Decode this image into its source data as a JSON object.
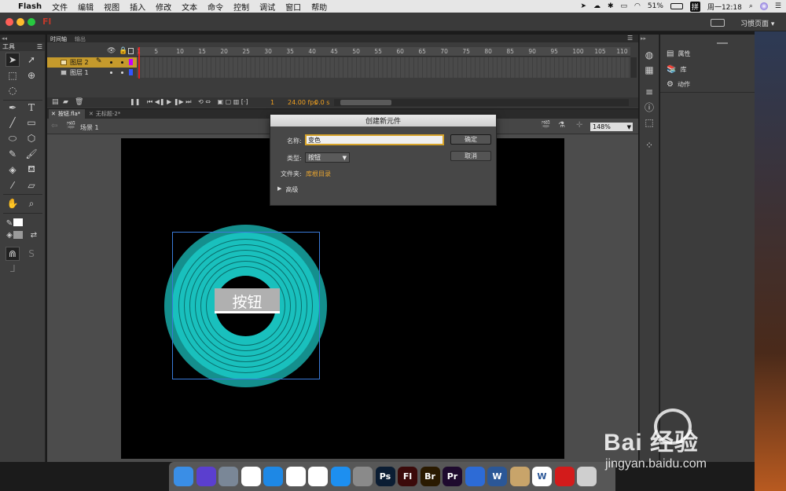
{
  "menubar": {
    "apple": "",
    "app": "Flash",
    "items": [
      "文件",
      "编辑",
      "视图",
      "插入",
      "修改",
      "文本",
      "命令",
      "控制",
      "调试",
      "窗口",
      "帮助"
    ],
    "battery": "51%",
    "input_method": "拼",
    "clock": "周一12:18"
  },
  "titlebar": {
    "app_icon": "Fl",
    "workspace": "习惯页面"
  },
  "tools": {
    "label": "工具",
    "icons": [
      "selection-tool",
      "subselection-tool",
      "free-transform-tool",
      "3d-rotation-tool",
      "lasso-tool",
      "pen-tool",
      "text-tool",
      "line-tool",
      "rectangle-tool",
      "oval-tool",
      "polystar-tool",
      "pencil-tool",
      "brush-tool",
      "paint-bucket-tool",
      "ink-bottle-tool",
      "eyedropper-tool",
      "eraser-tool",
      "hand-tool",
      "zoom-tool"
    ]
  },
  "timeline": {
    "tab_timeline": "时间轴",
    "tab_output": "输出",
    "frame_numbers": [
      "1",
      "5",
      "10",
      "15",
      "20",
      "25",
      "30",
      "35",
      "40",
      "45",
      "50",
      "55",
      "60",
      "65",
      "70",
      "75",
      "80",
      "85",
      "90",
      "95",
      "100",
      "105",
      "110"
    ],
    "layers": [
      {
        "name": "图层 2"
      },
      {
        "name": "图层 1"
      }
    ],
    "current_frame": "1",
    "fps": "24.00 fps",
    "time": "0.0 s"
  },
  "docs": {
    "tabs": [
      "按钮.fla*",
      "无标题-2*"
    ],
    "scene": "场景 1",
    "zoom": "148%"
  },
  "stage": {
    "button_text": "按钮",
    "colors": {
      "ring": "#19c0bd",
      "ring_outer": "#148f8d",
      "ring_line": "#0a6d6b",
      "stage": "#000000"
    }
  },
  "dialog": {
    "title": "创建新元件",
    "name_label": "名称:",
    "name_value": "变色",
    "type_label": "类型:",
    "type_value": "按钮",
    "folder_label": "文件夹:",
    "folder_value": "库根目录",
    "advanced": "高级",
    "ok": "确定",
    "cancel": "取消"
  },
  "right_panel": {
    "items": [
      {
        "label": "属性"
      },
      {
        "label": "库"
      },
      {
        "label": "动作"
      }
    ]
  },
  "dock": {
    "apps": [
      {
        "label": "",
        "bg": "#3a8ee6"
      },
      {
        "label": "",
        "bg": "#5b3fcf"
      },
      {
        "label": "",
        "bg": "#7a8797"
      },
      {
        "label": "",
        "bg": "#ffffff"
      },
      {
        "label": "",
        "bg": "#1e88e5"
      },
      {
        "label": "",
        "bg": "#ffffff"
      },
      {
        "label": "",
        "bg": "#ffffff"
      },
      {
        "label": "",
        "bg": "#1d8ff0"
      },
      {
        "label": "",
        "bg": "#8a8a8a"
      },
      {
        "label": "Ps",
        "bg": "#0b1d33"
      },
      {
        "label": "Fl",
        "bg": "#3b0a0a"
      },
      {
        "label": "Br",
        "bg": "#2a1a00"
      },
      {
        "label": "Pr",
        "bg": "#1e0a2e"
      },
      {
        "label": "",
        "bg": "#2d6bd6"
      },
      {
        "label": "W",
        "bg": "#2b5797"
      },
      {
        "label": "",
        "bg": "#c8a46a"
      },
      {
        "label": "W",
        "bg": "#ffffff"
      },
      {
        "label": "",
        "bg": "#d31b1b"
      },
      {
        "label": "",
        "bg": "#cfcfcf"
      }
    ]
  },
  "watermark": {
    "brand": "Bai  经验",
    "url": "jingyan.baidu.com"
  }
}
